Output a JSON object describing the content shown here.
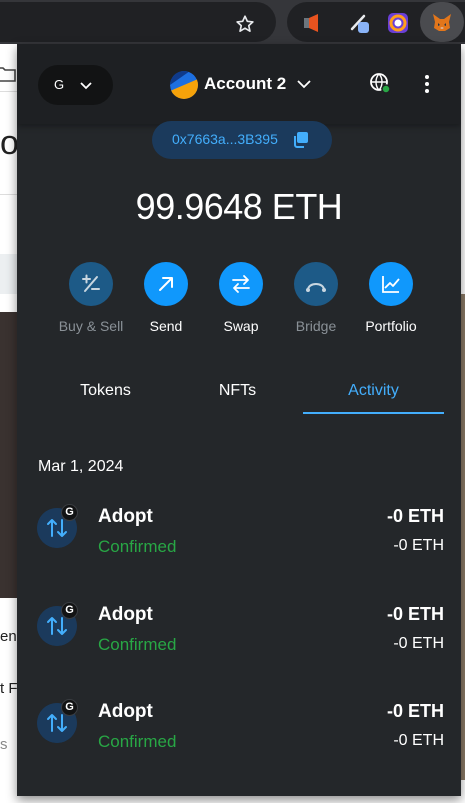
{
  "network": {
    "badge": "G"
  },
  "account": {
    "name": "Account 2",
    "address": "0x7663a...3B395"
  },
  "balance": "99.9648 ETH",
  "actions": [
    {
      "label": "Buy & Sell",
      "enabled": false
    },
    {
      "label": "Send",
      "enabled": true
    },
    {
      "label": "Swap",
      "enabled": true
    },
    {
      "label": "Bridge",
      "enabled": false
    },
    {
      "label": "Portfolio",
      "enabled": true
    }
  ],
  "tabs": [
    {
      "label": "Tokens",
      "active": false
    },
    {
      "label": "NFTs",
      "active": false
    },
    {
      "label": "Activity",
      "active": true
    }
  ],
  "activity": {
    "date": "Mar 1, 2024",
    "items": [
      {
        "title": "Adopt",
        "status": "Confirmed",
        "amount": "-0 ETH",
        "fiat": "-0 ETH",
        "badge": "G"
      },
      {
        "title": "Adopt",
        "status": "Confirmed",
        "amount": "-0 ETH",
        "fiat": "-0 ETH",
        "badge": "G"
      },
      {
        "title": "Adopt",
        "status": "Confirmed",
        "amount": "-0 ETH",
        "fiat": "-0 ETH",
        "badge": "G"
      }
    ]
  },
  "colors": {
    "accent": "#43aefc",
    "popup_bg": "#24272a",
    "header_bg": "#1e2023",
    "status_confirmed": "#28a745",
    "action_enabled": "#1098fc",
    "action_disabled": "#1d5a87"
  },
  "background_page": {
    "fragments": [
      "o",
      "en",
      "t F",
      "s"
    ]
  }
}
